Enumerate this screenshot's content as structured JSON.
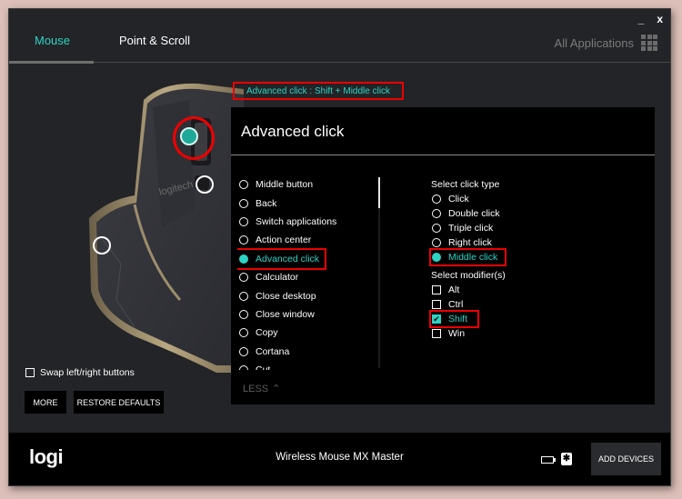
{
  "window": {
    "minimize_icon": "_",
    "close_icon": "x"
  },
  "tabs": [
    {
      "label": "Mouse",
      "active": true
    },
    {
      "label": "Point & Scroll",
      "active": false
    }
  ],
  "all_apps": {
    "label": "All Applications",
    "icon": "grid-icon"
  },
  "summary": "Advanced click : Shift + Middle click",
  "panel": {
    "title": "Advanced click",
    "actions": [
      {
        "label": "Middle button",
        "selected": false
      },
      {
        "label": "Back",
        "selected": false
      },
      {
        "label": "Switch applications",
        "selected": false
      },
      {
        "label": "Action center",
        "selected": false
      },
      {
        "label": "Advanced click",
        "selected": true
      },
      {
        "label": "Calculator",
        "selected": false
      },
      {
        "label": "Close desktop",
        "selected": false
      },
      {
        "label": "Close window",
        "selected": false
      },
      {
        "label": "Copy",
        "selected": false
      },
      {
        "label": "Cortana",
        "selected": false
      },
      {
        "label": "Cut",
        "selected": false
      }
    ],
    "less_label": "LESS",
    "click_type_heading": "Select click type",
    "click_types": [
      {
        "label": "Click",
        "selected": false
      },
      {
        "label": "Double click",
        "selected": false
      },
      {
        "label": "Triple click",
        "selected": false
      },
      {
        "label": "Right click",
        "selected": false
      },
      {
        "label": "Middle click",
        "selected": true
      }
    ],
    "modifier_heading": "Select modifier(s)",
    "modifiers": [
      {
        "label": "Alt",
        "checked": false
      },
      {
        "label": "Ctrl",
        "checked": false
      },
      {
        "label": "Shift",
        "checked": true
      },
      {
        "label": "Win",
        "checked": false
      }
    ]
  },
  "mouse": {
    "brand_text": "logitech"
  },
  "swap_label": "Swap left/right buttons",
  "buttons": {
    "more": "MORE",
    "restore": "RESTORE DEFAULTS"
  },
  "footer": {
    "logo": "logi",
    "device_name": "Wireless Mouse MX Master",
    "battery_icon": "battery-icon",
    "bluetooth_icon": "bluetooth-icon",
    "add_devices": "ADD DEVICES"
  },
  "colors": {
    "accent": "#2dd4c4",
    "highlight": "#e00000",
    "background": "#232427"
  }
}
